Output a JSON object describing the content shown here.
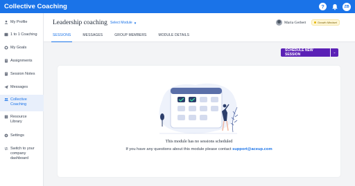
{
  "app": {
    "title": "Collective Coaching"
  },
  "topbar": {
    "help_glyph": "?",
    "avatar_initials": "ZB"
  },
  "sidebar": {
    "items": [
      {
        "label": "My Profile",
        "icon": "user-icon"
      },
      {
        "label": "1 to 1 Coaching",
        "icon": "coaching-icon"
      },
      {
        "label": "My Goals",
        "icon": "goals-icon"
      },
      {
        "label": "Assignments",
        "icon": "assignments-icon"
      },
      {
        "label": "Session Notes",
        "icon": "notes-icon"
      },
      {
        "label": "Messages",
        "icon": "paper-plane-icon"
      },
      {
        "label": "Collective Coaching",
        "icon": "people-icon",
        "active": true
      },
      {
        "label": "Resource Library",
        "icon": "book-icon"
      },
      {
        "label": "Settings",
        "icon": "gear-icon"
      },
      {
        "label": "Switch to your company dashboard",
        "icon": "switch-icon"
      }
    ]
  },
  "header": {
    "title": "Leadership coaching",
    "module_select": "Select Module",
    "user_name": "Maria Gerbert",
    "badge": "Growth Mindset"
  },
  "tabs": [
    {
      "label": "SESSIONS",
      "active": true
    },
    {
      "label": "MESSAGES"
    },
    {
      "label": "GROUP MEMBERS"
    },
    {
      "label": "MODULE DETAILS"
    }
  ],
  "actions": {
    "schedule_label": "SCHEDULE NEW SESSION"
  },
  "empty_state": {
    "title": "This module has no sessions scheduled",
    "help_text": "If you have any questions about this module please contact ",
    "help_link": "support@aceup.com"
  },
  "colors": {
    "brand": "#1a73e8",
    "accent": "#5b21b6"
  }
}
